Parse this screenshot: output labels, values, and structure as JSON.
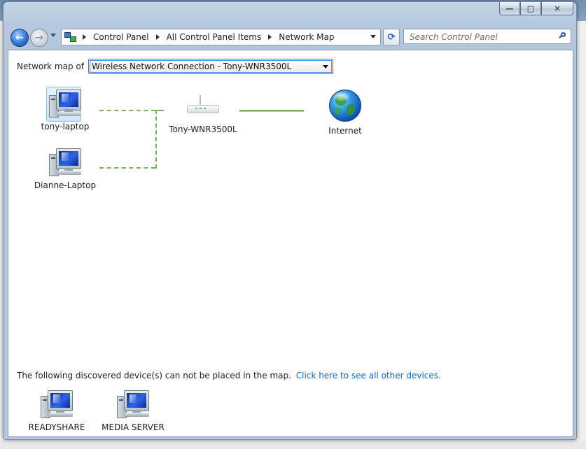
{
  "window": {
    "minimize_glyph": "—",
    "maximize_glyph": "□",
    "close_glyph": "✕"
  },
  "navigation": {
    "back_glyph": "←",
    "forward_glyph": "→",
    "breadcrumbs": [
      "Control Panel",
      "All Control Panel Items",
      "Network Map"
    ],
    "refresh_glyph": "⟳",
    "search_placeholder": "Search Control Panel"
  },
  "map": {
    "label": "Network map of",
    "selected_connection": "Wireless Network Connection - Tony-WNR3500L",
    "devices": {
      "computer_1": "tony-laptop",
      "computer_2": "Dianne-Laptop",
      "router": "Tony-WNR3500L",
      "internet": "Internet"
    }
  },
  "discovered": {
    "message": "The following discovered device(s) can not be placed in the map.",
    "link_text": "Click here to see all other devices.",
    "devices": [
      "READYSHARE",
      "MEDIA SERVER"
    ]
  },
  "colors": {
    "connection_line": "#78b05e",
    "link": "#0b66c2"
  }
}
